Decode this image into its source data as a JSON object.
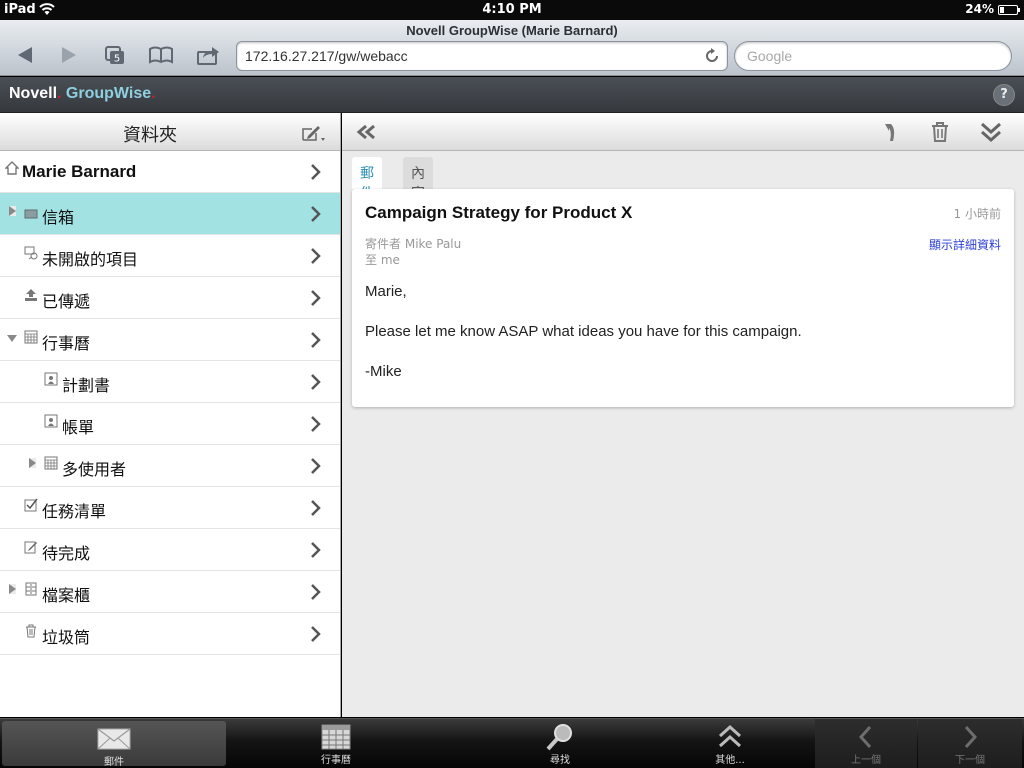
{
  "status": {
    "device": "iPad",
    "time": "4:10 PM",
    "battery": "24%",
    "battery_level": 0.24
  },
  "browser": {
    "title": "Novell GroupWise (Marie Barnard)",
    "tab_count": "5",
    "url": "172.16.27.217/gw/webacc",
    "search_placeholder": "Google"
  },
  "app": {
    "brand_a": "Novell",
    "brand_b": "GroupWise",
    "help": "?"
  },
  "sidebar": {
    "title": "資料夾",
    "folders": [
      {
        "label": "Marie Barnard",
        "icon": "home-icon"
      },
      {
        "label": "信箱",
        "icon": "mailbox-icon"
      },
      {
        "label": "未開啟的項目",
        "icon": "unopened-icon"
      },
      {
        "label": "已傳遞",
        "icon": "sent-icon"
      },
      {
        "label": "行事曆",
        "icon": "calendar-icon"
      },
      {
        "label": "計劃書",
        "icon": "planner-icon"
      },
      {
        "label": "帳單",
        "icon": "planner-icon"
      },
      {
        "label": "多使用者",
        "icon": "calendar-icon"
      },
      {
        "label": "任務清單",
        "icon": "tasklist-icon"
      },
      {
        "label": "待完成",
        "icon": "work-in-progress-icon"
      },
      {
        "label": "檔案櫃",
        "icon": "cabinet-icon"
      },
      {
        "label": "垃圾筒",
        "icon": "trash-icon"
      }
    ]
  },
  "message": {
    "tabs": [
      "郵件",
      "內容"
    ],
    "subject": "Campaign Strategy for Product X",
    "time": "1 小時前",
    "from_label": "寄件者",
    "from": "Mike Palu",
    "to_label": "至",
    "to": "me",
    "details_link": "顯示詳細資料",
    "body": [
      "Marie,",
      "Please let me know ASAP what ideas you have for this campaign.",
      "-Mike"
    ]
  },
  "tabbar": {
    "mail": "郵件",
    "calendar": "行事曆",
    "find": "尋找",
    "more": "其他...",
    "prev": "上一個",
    "next": "下一個"
  },
  "colors": {
    "selected_row": "#a2e2e2",
    "accent": "#2a8fb0",
    "link": "#2c3fd6"
  }
}
